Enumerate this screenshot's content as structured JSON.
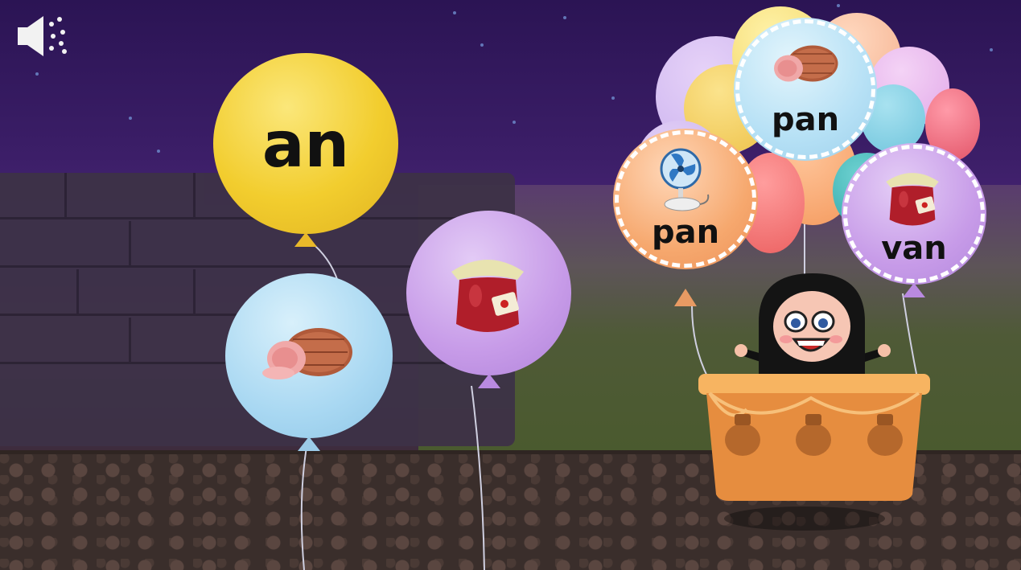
{
  "sound_button": {
    "icon": "speaker-sound-icon"
  },
  "target_balloon": {
    "word": "an",
    "color": "#f2cd2e"
  },
  "free_balloons": [
    {
      "picture": "ham-icon",
      "color": "#a9d8f2"
    },
    {
      "picture": "jam-jar-icon",
      "color": "#c79be8"
    }
  ],
  "bundle_balloons": [
    {
      "word": "pan",
      "picture": "ham-icon",
      "color": "#b5e0f5"
    },
    {
      "word": "pan",
      "picture": "fan-icon",
      "color": "#f6a86e"
    },
    {
      "word": "van",
      "picture": "jam-jar-icon",
      "color": "#c79be8"
    }
  ],
  "character": {
    "name": "kid-in-basket"
  }
}
